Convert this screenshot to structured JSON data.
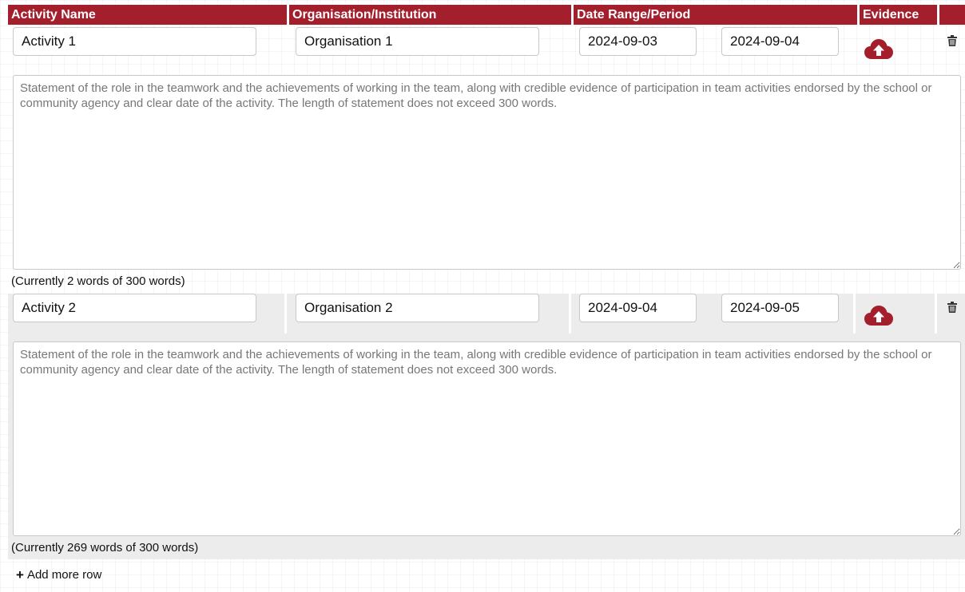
{
  "header": {
    "activity_name": "Activity Name",
    "organisation": "Organisation/Institution",
    "date_range": "Date Range/Period",
    "evidence": "Evidence"
  },
  "rows": [
    {
      "activity_name": "Activity 1",
      "organisation": "Organisation 1",
      "date_from": "2024-09-03",
      "date_to": "2024-09-04",
      "statement_value": "",
      "statement_placeholder": "Statement of the role in the teamwork and the achievements of working in the team, along with credible evidence of participation in team activities endorsed by the school or community agency and clear date of the activity. The length of statement does not exceed 300 words.",
      "word_count_text": "(Currently 2 words of 300 words)",
      "upload_icon": "cloud-upload-icon",
      "delete_icon": "trash-icon"
    },
    {
      "activity_name": "Activity 2",
      "organisation": "Organisation 2",
      "date_from": "2024-09-04",
      "date_to": "2024-09-05",
      "statement_value": "",
      "statement_placeholder": "Statement of the role in the teamwork and the achievements of working in the team, along with credible evidence of participation in team activities endorsed by the school or community agency and clear date of the activity. The length of statement does not exceed 300 words.",
      "word_count_text": "(Currently 269 words of 300 words)",
      "upload_icon": "cloud-upload-icon",
      "delete_icon": "trash-icon"
    }
  ],
  "add_row_label": "Add more row",
  "colors": {
    "accent": "#a31f2c",
    "alt_row": "#ececec"
  }
}
